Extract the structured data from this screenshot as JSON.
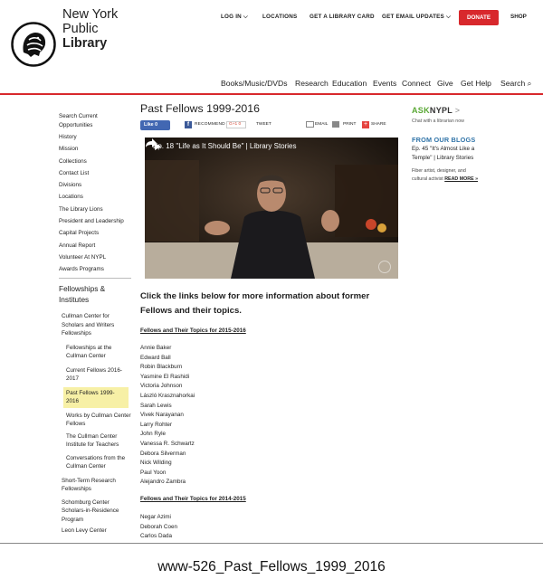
{
  "header": {
    "brand_line1": "New York",
    "brand_line2": "Public",
    "brand_line3": "Library",
    "top_links": {
      "login": "LOG IN",
      "locations": "LOCATIONS",
      "card": "GET A LIBRARY CARD",
      "email": "GET EMAIL UPDATES",
      "donate": "DONATE",
      "shop": "SHOP"
    },
    "main_nav": [
      "Books/Music/DVDs",
      "Research",
      "Education",
      "Events",
      "Connect",
      "Give",
      "Get Help"
    ],
    "search_label": "Search",
    "accent_color": "#d8282c",
    "link_color": "#3174a8"
  },
  "sidebar": {
    "links": [
      "Search Current Opportunities",
      "History",
      "Mission",
      "Collections",
      "Contact List",
      "Divisions",
      "Locations",
      "The Library Lions",
      "President and Leadership",
      "Capital Projects",
      "Annual Report",
      "Volunteer At NYPL",
      "Awards Programs"
    ],
    "section_title": "Fellowships & Institutes",
    "subnav": {
      "cullman": "Cullman Center for Scholars and Writers Fellowships",
      "at_center": "Fellowships at the Cullman Center",
      "current": "Current Fellows 2016-2017",
      "past": "Past Fellows 1999-2016",
      "works": "Works by Cullman Center Fellows",
      "institute": "The Cullman Center Institute for Teachers",
      "conversations": "Conversations from the Cullman Center",
      "short_term": "Short-Term Research Fellowships",
      "schomburg": "Schomburg Center Scholars-in-Residence Program",
      "leon": "Leon Levy Center"
    }
  },
  "main": {
    "title": "Past Fellows 1999-2016",
    "share": {
      "like": "Like 0",
      "recommend": "RECOMMEND",
      "gplus": "G+1 0",
      "tweet": "TWEET",
      "email": "EMAIL",
      "print": "PRINT",
      "share": "SHARE"
    },
    "video_title": "Ep. 18 \"Life as It Should Be\" | Library Stories",
    "intro": "Click the links below for more information about former Fellows and their topics.",
    "group1_heading": "Fellows and Their Topics for 2015-2016",
    "group1_names": [
      "Annie Baker",
      "Edward Ball",
      "Robin Blackburn",
      "Yasmine El Rashidi",
      "Victoria Johnson",
      "László Krasznahorkai",
      "Sarah Lewis",
      "Vivek Narayanan",
      "Larry Rohter",
      "John Ryle",
      "Vanessa R. Schwartz",
      "Debora Silverman",
      "Nick Wilding",
      "Paul Yoon",
      "Alejandro Zambra"
    ],
    "group2_heading": "Fellows and Their Topics for 2014-2015",
    "group2_names": [
      "Negar Azimi",
      "Deborah Coen",
      "Carlos Dada"
    ]
  },
  "right": {
    "ask_a": "ASK",
    "ask_b": "NYPL",
    "ask_gt": ">",
    "ask_sub": "Chat with a librarian now",
    "blogs_heading": "FROM OUR BLOGS",
    "blog_title": "Ep. 45 \"It's Almost Like a Temple\" | Library Stories",
    "blog_desc": "Fiber artist, designer, and cultural activist",
    "read_more": "READ MORE »"
  },
  "caption": "www-526_Past_Fellows_1999_2016"
}
